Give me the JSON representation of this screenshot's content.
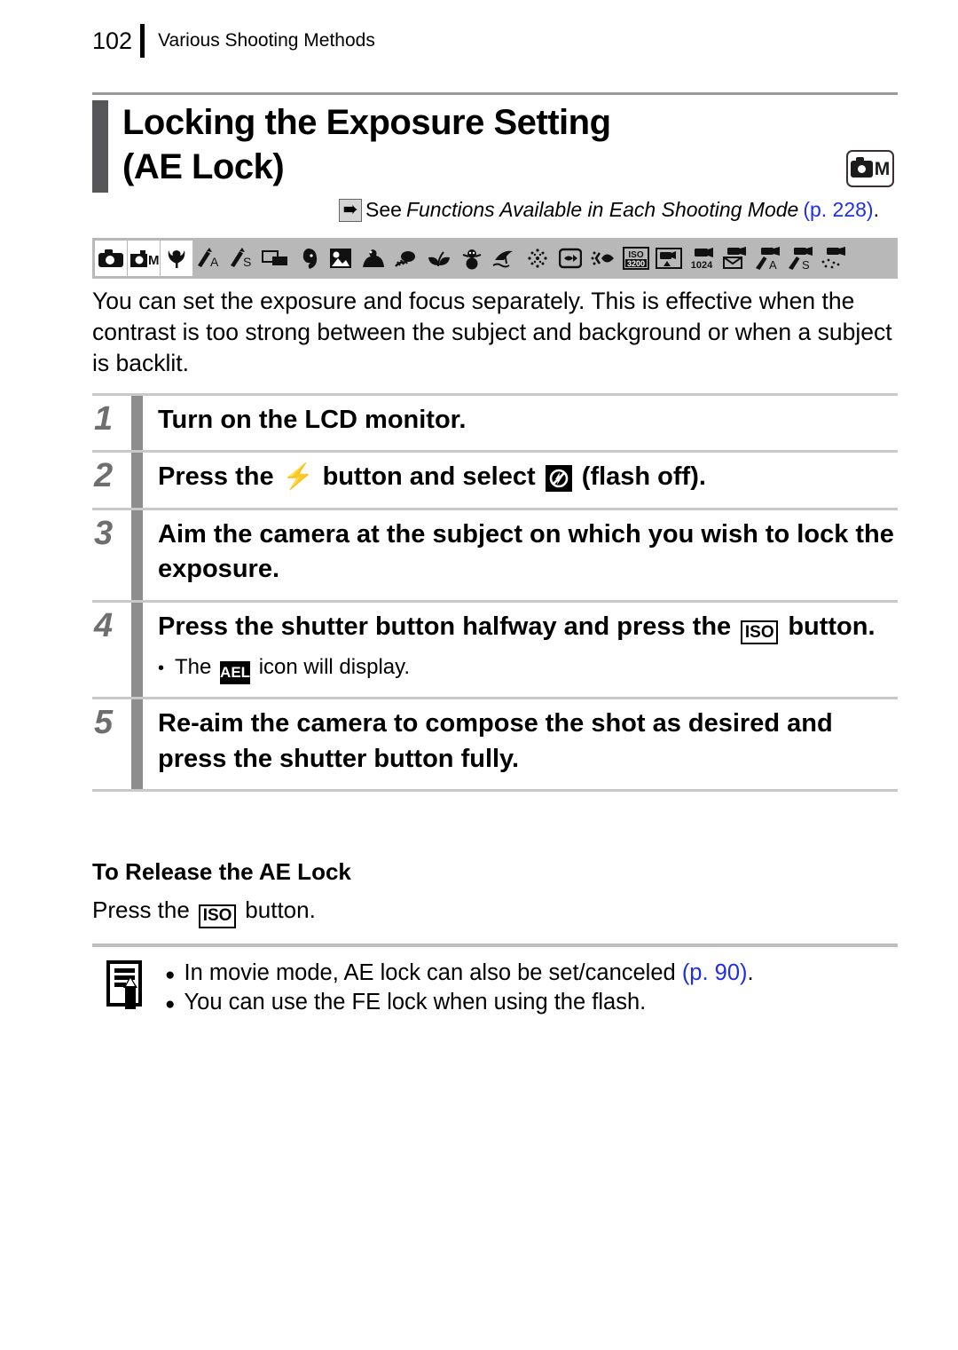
{
  "header": {
    "page_number": "102",
    "section_title": "Various Shooting Methods"
  },
  "title": {
    "line1": "Locking the Exposure Setting",
    "line2": "(AE Lock)",
    "mode_badge": {
      "icon": "camera-icon",
      "letter": "M"
    }
  },
  "see_also": {
    "arrow_icon": "arrow-right-icon",
    "see_word": "See",
    "reference_title": "Functions Available in Each Shooting Mode",
    "page_ref": "(p. 228)",
    "trailing": "."
  },
  "mode_icon_strip": [
    {
      "name": "camera-auto-icon",
      "active": true
    },
    {
      "name": "camera-manual-m-icon",
      "active": true
    },
    {
      "name": "digital-macro-tulip-icon",
      "active": true
    },
    {
      "name": "aperture-priority-av-icon",
      "active": false
    },
    {
      "name": "shutter-priority-tv-icon",
      "active": false
    },
    {
      "name": "stitch-assist-icon",
      "active": false
    },
    {
      "name": "portrait-icon",
      "active": false
    },
    {
      "name": "night-snapshot-icon",
      "active": false
    },
    {
      "name": "kids-and-pets-icon",
      "active": false
    },
    {
      "name": "indoor-icon",
      "active": false
    },
    {
      "name": "foliage-icon",
      "active": false
    },
    {
      "name": "snow-person-icon",
      "active": false
    },
    {
      "name": "beach-icon",
      "active": false
    },
    {
      "name": "fireworks-icon",
      "active": false
    },
    {
      "name": "aquarium-icon",
      "active": false
    },
    {
      "name": "underwater-icon",
      "active": false
    },
    {
      "name": "iso-3200-icon",
      "active": false
    },
    {
      "name": "movie-standard-icon",
      "active": false
    },
    {
      "name": "movie-1024-icon",
      "active": false
    },
    {
      "name": "movie-mail-icon",
      "active": false
    },
    {
      "name": "movie-color-accent-icon",
      "active": false
    },
    {
      "name": "movie-color-swap-icon",
      "active": false
    },
    {
      "name": "time-lapse-movie-icon",
      "active": false
    }
  ],
  "intro": "You can set the exposure and focus separately. This is effective when the contrast is too strong between the subject and background or when a subject is backlit.",
  "steps": [
    {
      "number": "1",
      "text_before": "Turn on the LCD monitor.",
      "text_after": "",
      "glyph": null,
      "note": null
    },
    {
      "number": "2",
      "text_before": "Press the",
      "text_mid": "button and select",
      "text_after": "(flash off).",
      "glyph_flash": "flash-bolt-icon",
      "glyph_flash_off": "flash-off-icon"
    },
    {
      "number": "3",
      "text_before": "Aim the camera at the subject on which you wish to lock the exposure."
    },
    {
      "number": "4",
      "text_before": "Press the shutter button halfway and press the",
      "glyph_iso": "ISO",
      "text_after": "button.",
      "note_before": "The",
      "note_glyph": "AEL",
      "note_after": "icon will display."
    },
    {
      "number": "5",
      "text_before": "Re-aim the camera to compose the shot as desired and press the shutter button fully."
    }
  ],
  "release_section": {
    "title": "To Release the AE Lock",
    "text_before": "Press the",
    "glyph_iso": "ISO",
    "text_after": "button."
  },
  "note_box": {
    "icon": "notepad-pencil-icon",
    "items": [
      {
        "text": "In movie mode, AE lock can also be set/canceled",
        "page_ref": "(p. 90)",
        "trailing": "."
      },
      {
        "text": "You can use the FE lock when using the flash.",
        "page_ref": "",
        "trailing": ""
      }
    ]
  },
  "colors": {
    "link_blue": "#2030e0",
    "title_bar_gray": "#57575a",
    "step_bar_gray": "#8d8d8d",
    "icon_strip_gray": "#b8b8b8",
    "rule_gray": "#c9c9c9"
  }
}
